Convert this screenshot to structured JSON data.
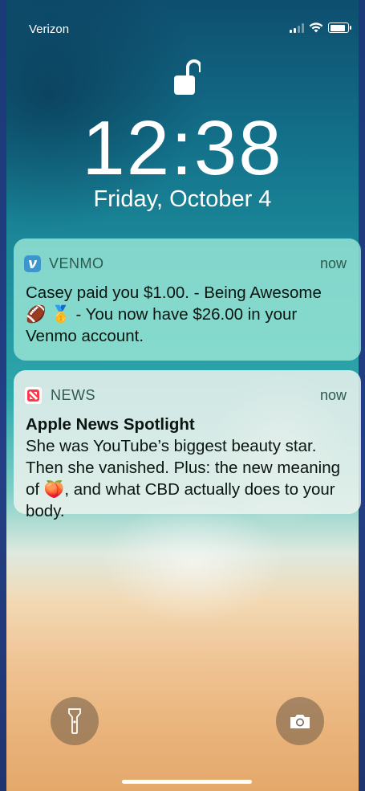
{
  "status_bar": {
    "carrier": "Verizon"
  },
  "lock_screen": {
    "time": "12:38",
    "date": "Friday, October 4"
  },
  "notifications": [
    {
      "app": "VENMO",
      "time": "now",
      "icon": "venmo-icon",
      "accent": "#3d95ce",
      "body": "Casey paid you $1.00. - Being Awesome 🏈 🥇 - You now have $26.00 in your Venmo account."
    },
    {
      "app": "NEWS",
      "time": "now",
      "icon": "apple-news-icon",
      "accent": "#fa3a4a",
      "title": "Apple News Spotlight",
      "body": "She was YouTube’s biggest beauty star. Then she vanished. Plus: the new meaning of 🍑, and what CBD actually does to your body."
    }
  ],
  "controls": {
    "left": "flashlight-icon",
    "right": "camera-icon"
  }
}
